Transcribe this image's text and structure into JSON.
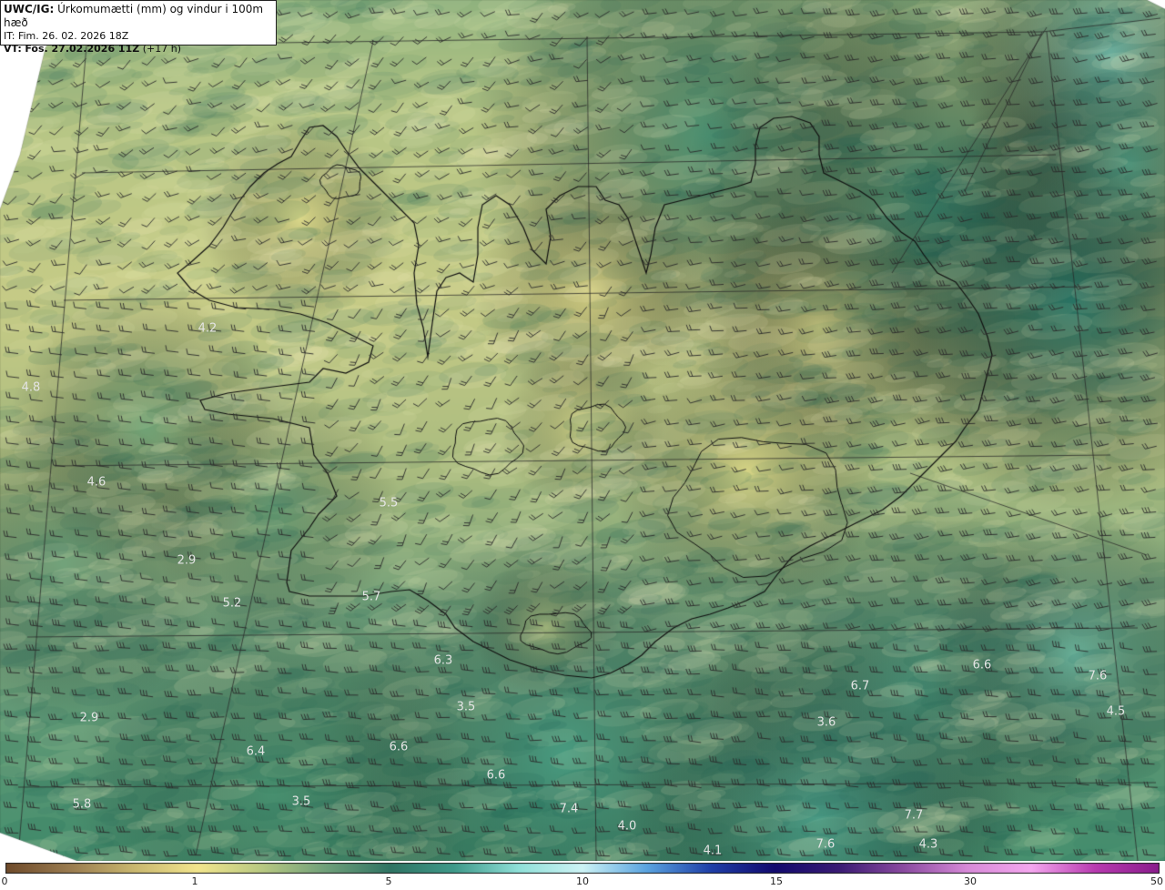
{
  "header": {
    "product": "UWC/IG:",
    "title": "Úrkomumætti (mm) og vindur i 100m hæð",
    "init_time": "IT: Fim. 26. 02. 2026 18Z",
    "valid_label": "VT:",
    "valid_time": "Fös. 27.02.2026 11Z",
    "lead": "(+17 h)"
  },
  "map_values": [
    {
      "text": "4.2"
    },
    {
      "text": "4.8"
    },
    {
      "text": "4.6"
    },
    {
      "text": "2.9"
    },
    {
      "text": "5.2"
    },
    {
      "text": "5.5"
    },
    {
      "text": "5.7"
    },
    {
      "text": "6.3"
    },
    {
      "text": "3.5"
    },
    {
      "text": "2.9"
    },
    {
      "text": "6.4"
    },
    {
      "text": "6.6"
    },
    {
      "text": "6.6"
    },
    {
      "text": "5.8"
    },
    {
      "text": "3.5"
    },
    {
      "text": "7.4"
    },
    {
      "text": "4.0"
    },
    {
      "text": "4.1"
    },
    {
      "text": "6.7"
    },
    {
      "text": "3.6"
    },
    {
      "text": "6.6"
    },
    {
      "text": "7.6"
    },
    {
      "text": "4.5"
    },
    {
      "text": "7.7"
    },
    {
      "text": "7.6"
    },
    {
      "text": "4.3"
    }
  ],
  "colorbar": {
    "ticks": [
      "0",
      "1",
      "5",
      "10",
      "15",
      "30",
      "50"
    ],
    "colors": [
      "#6e4a2a",
      "#9a7b4f",
      "#c9b76f",
      "#f2e58d",
      "#b9c982",
      "#6fa07a",
      "#2f7463",
      "#3f9a8a",
      "#8fe0d8",
      "#cdf3f5",
      "#5aa4e0",
      "#1f3fa8",
      "#120a6e",
      "#3a1b74",
      "#8a4aa0",
      "#d78ad8",
      "#f5a7ef",
      "#b83ab0",
      "#8a1c8c"
    ]
  },
  "colors": {
    "land": "#d6d694",
    "sea_north": "#2f8a72",
    "sea_south": "#4c9274",
    "coast": "#111111",
    "grid": "#333333",
    "barb": "#2a2a2a"
  }
}
